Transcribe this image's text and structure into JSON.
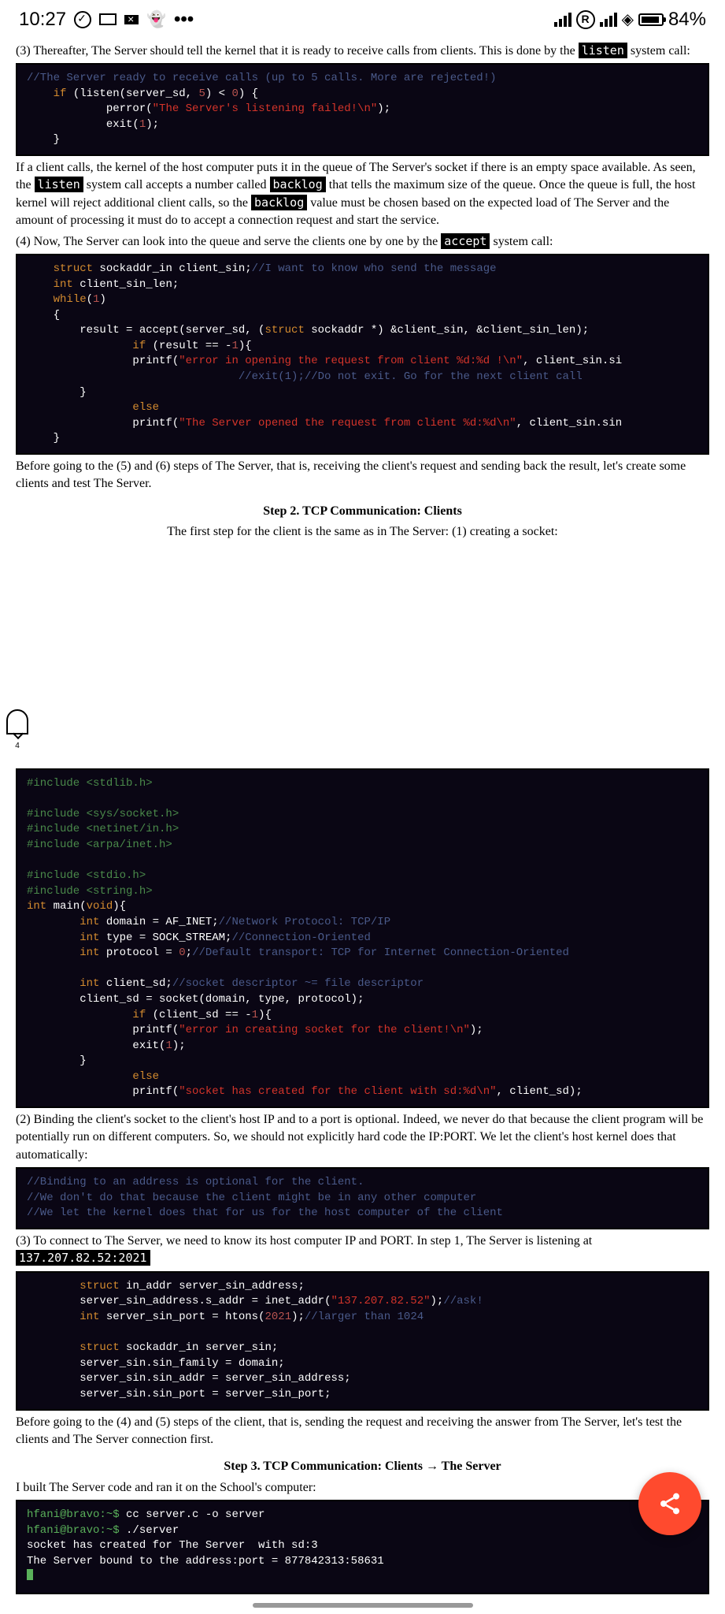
{
  "status": {
    "time": "10:27",
    "battery": "84%",
    "r": "R"
  },
  "side_badge": "4",
  "p1": "(3) Thereafter, The Server should tell the kernel that it is ready to receive calls from clients. This is done by the ",
  "p1_code": "listen",
  "p1_end": " system call:",
  "code1": {
    "c1": "//The Server ready to receive calls (up to 5 calls. More are rejected!)",
    "l1a": "if",
    "l1b": " (listen(server_sd, ",
    "l1c": "5",
    "l1d": ") < ",
    "l1e": "0",
    "l1f": ") {",
    "l2a": "            perror(",
    "l2b": "\"The Server's listening failed!\\n\"",
    "l2c": ");",
    "l3a": "            exit(",
    "l3b": "1",
    "l3c": ");",
    "l4": "    }"
  },
  "p2a": "If a client calls, the kernel of the host computer puts it in the queue of The Server's socket if there is an empty space available. As seen, the ",
  "p2_c1": "listen",
  "p2b": " system call accepts a number called ",
  "p2_c2": "backlog",
  "p2c": " that tells the maximum size of the queue. Once the queue is full, the host kernel will reject additional client calls, so the ",
  "p2_c3": "backlog",
  "p2d": " value must be chosen based on the expected load of The Server and the amount of processing it must do to accept a connection request and start the service.",
  "p3a": "(4) Now, The Server can look into the queue and serve the clients one by one by the ",
  "p3_c": "accept",
  "p3b": " system call:",
  "code2": {
    "l1a": "struct",
    "l1b": " sockaddr_in client_sin;",
    "l1c": "//I want to know who send the message",
    "l2a": "int",
    "l2b": " client_sin_len;",
    "l3a": "while",
    "l3b": "(",
    "l3c": "1",
    "l3d": ")",
    "l4": "{",
    "l5a": "        result = accept(server_sd, (",
    "l5b": "struct",
    "l5c": " sockaddr *) &client_sin, &client_sin_len);",
    "l6a": "        if",
    "l6b": " (result == -",
    "l6c": "1",
    "l6d": "){",
    "l7a": "                printf(",
    "l7b": "\"error in opening the request from client %d:%d !\\n\"",
    "l7c": ", client_sin.si",
    "l8": "                //exit(1);//Do not exit. Go for the next client call",
    "l9": "        }",
    "l10": "        else",
    "l11a": "                printf(",
    "l11b": "\"The Server opened the request from client %d:%d\\n\"",
    "l11c": ", client_sin.sin",
    "l12": "}"
  },
  "p4": "Before going to the (5) and (6) steps of The Server, that is, receiving the client's request and sending back the result, let's create some clients and test The Server.",
  "step2": "Step 2. TCP Communication: Clients",
  "p5": "The first step for the client is the same as in The Server: (1) creating a socket:",
  "code3": {
    "l1": "#include <stdlib.h>",
    "l2": "#include <sys/socket.h>",
    "l3": "#include <netinet/in.h>",
    "l4": "#include <arpa/inet.h>",
    "l5": "#include <stdio.h>",
    "l6": "#include <string.h>",
    "l7a": "int",
    "l7b": " main(",
    "l7c": "void",
    "l7d": "){",
    "l8a": "        int",
    "l8b": " domain = AF_INET;",
    "l8c": "//Network Protocol: TCP/IP",
    "l9a": "        int",
    "l9b": " type = SOCK_STREAM;",
    "l9c": "//Connection-Oriented",
    "l10a": "        int",
    "l10b": " protocol = ",
    "l10c": "0",
    "l10d": ";",
    "l10e": "//Default transport: TCP for Internet Connection-Oriented",
    "l11a": "        int",
    "l11b": " client_sd;",
    "l11c": "//socket descriptor ~= file descriptor",
    "l12": "        client_sd = socket(domain, type, protocol);",
    "l13a": "        if",
    "l13b": " (client_sd == -",
    "l13c": "1",
    "l13d": "){",
    "l14a": "                printf(",
    "l14b": "\"error in creating socket for the client!\\n\"",
    "l14c": ");",
    "l15a": "                exit(",
    "l15b": "1",
    "l15c": ");",
    "l16": "        }",
    "l17": "        else",
    "l18a": "                printf(",
    "l18b": "\"socket has created for the client with sd:%d\\n\"",
    "l18c": ", client_sd);"
  },
  "p6": "(2) Binding the client's socket to the client's host IP and to a port is optional. Indeed, we never do that because the client program will be potentially run on different computers. So, we should not explicitly hard code the IP:PORT. We let the client's host kernel does that automatically:",
  "code4": {
    "l1": "//Binding to an address is optional for the client.",
    "l2": "//We don't do that because the client might be in any other computer",
    "l3": "//We let the kernel does that for us for the host computer of the client"
  },
  "p7a": "(3) To connect to The Server, we need to know its host computer IP and PORT. In step 1, The Server is listening at ",
  "p7_c": "137.207.82.52:2021",
  "code5": {
    "l1a": "struct",
    "l1b": " in_addr server_sin_address;",
    "l2a": "server_sin_address.s_addr = inet_addr(",
    "l2b": "\"137.207.82.52\"",
    "l2c": ");",
    "l2d": "//ask!",
    "l3a": "int",
    "l3b": " server_sin_port = htons(",
    "l3c": "2021",
    "l3d": ");",
    "l3e": "//larger than 1024",
    "l4a": "struct",
    "l4b": " sockaddr_in server_sin;",
    "l5": "server_sin.sin_family = domain;",
    "l6": "server_sin.sin_addr = server_sin_address;",
    "l7": "server_sin.sin_port = server_sin_port;"
  },
  "p8": "Before going to the (4) and (5) steps of the client, that is, sending the request and receiving the answer from The Server, let's test the clients and The Server connection first.",
  "step3": "Step 3. TCP Communication: Clients → The Server",
  "p9": "I built The Server code and ran it on the School's computer:",
  "code6": {
    "l1a": "hfani@bravo:~$",
    "l1b": " cc server.c -o server",
    "l2a": "hfani@bravo:~$",
    "l2b": " ./server",
    "l3": "socket has created for The Server  with sd:3",
    "l4": "The Server bound to the address:port = 877842313:58631"
  }
}
